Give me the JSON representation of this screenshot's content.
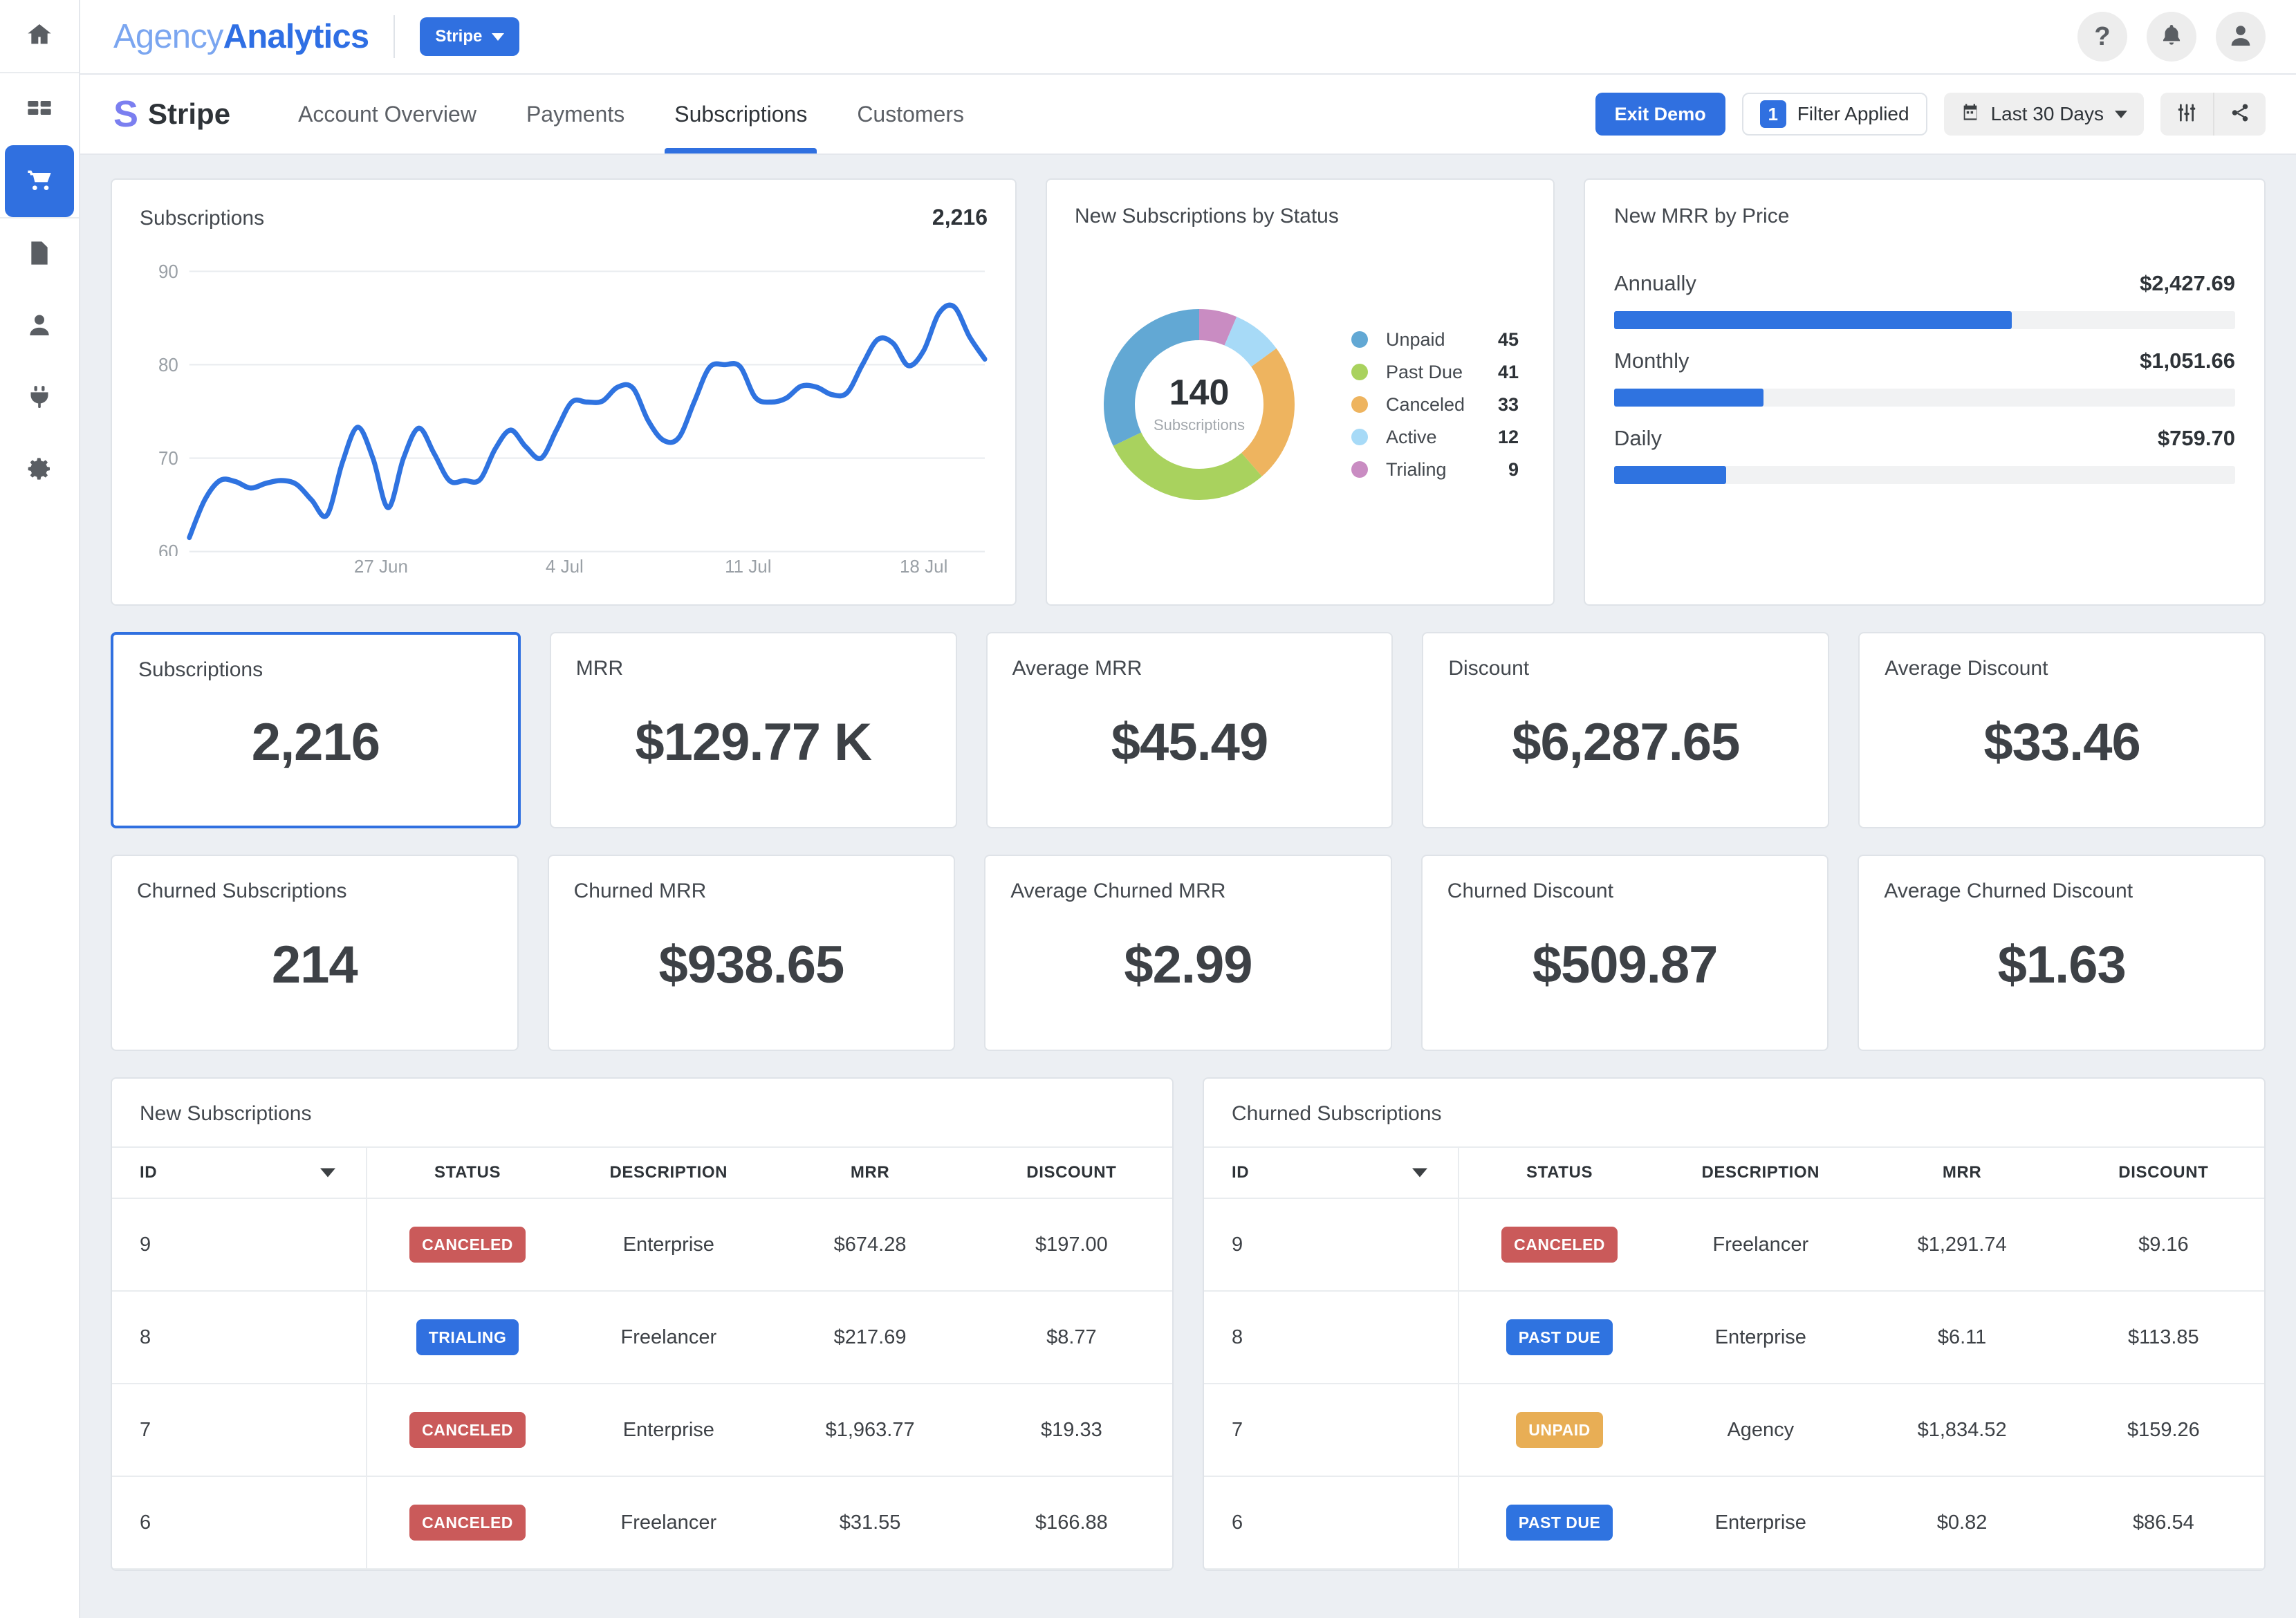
{
  "rail": {
    "items": [
      {
        "name": "home-icon",
        "active": false
      },
      {
        "name": "dashboard-grid-icon",
        "active": false
      },
      {
        "name": "cart-icon",
        "active": true
      },
      {
        "name": "report-file-icon",
        "active": false
      },
      {
        "name": "user-icon",
        "active": false
      },
      {
        "name": "plug-icon",
        "active": false
      },
      {
        "name": "gear-icon",
        "active": false
      }
    ]
  },
  "brandbar": {
    "logo_part1": "Agency",
    "logo_part2": "Analytics",
    "account_label": "Stripe",
    "help_glyph": "?",
    "icons": [
      "help-icon",
      "bell-icon",
      "avatar-icon"
    ]
  },
  "nav": {
    "mark": "S",
    "name": "Stripe",
    "tabs": [
      {
        "label": "Account Overview",
        "active": false
      },
      {
        "label": "Payments",
        "active": false
      },
      {
        "label": "Subscriptions",
        "active": true
      },
      {
        "label": "Customers",
        "active": false
      }
    ],
    "exit_demo": "Exit Demo",
    "filter_count": "1",
    "filter_label": "Filter Applied",
    "date_range": "Last 30 Days"
  },
  "subscriptions_panel": {
    "title": "Subscriptions",
    "total": "2,216"
  },
  "donut_panel": {
    "title": "New Subscriptions by Status",
    "center_value": "140",
    "center_label": "Subscriptions"
  },
  "mrr_panel": {
    "title": "New MRR by Price",
    "items": [
      {
        "label": "Annually",
        "value": "$2,427.69",
        "pct": 64
      },
      {
        "label": "Monthly",
        "value": "$1,051.66",
        "pct": 24
      },
      {
        "label": "Daily",
        "value": "$759.70",
        "pct": 18
      }
    ]
  },
  "kpis_row1": [
    {
      "label": "Subscriptions",
      "value": "2,216",
      "selected": true
    },
    {
      "label": "MRR",
      "value": "$129.77 K",
      "selected": false
    },
    {
      "label": "Average MRR",
      "value": "$45.49",
      "selected": false
    },
    {
      "label": "Discount",
      "value": "$6,287.65",
      "selected": false
    },
    {
      "label": "Average Discount",
      "value": "$33.46",
      "selected": false
    }
  ],
  "kpis_row2": [
    {
      "label": "Churned Subscriptions",
      "value": "214",
      "selected": false
    },
    {
      "label": "Churned MRR",
      "value": "$938.65",
      "selected": false
    },
    {
      "label": "Average Churned MRR",
      "value": "$2.99",
      "selected": false
    },
    {
      "label": "Churned Discount",
      "value": "$509.87",
      "selected": false
    },
    {
      "label": "Average Churned Discount",
      "value": "$1.63",
      "selected": false
    }
  ],
  "table_new": {
    "title": "New Subscriptions",
    "columns": [
      "ID",
      "STATUS",
      "DESCRIPTION",
      "MRR",
      "DISCOUNT"
    ],
    "rows": [
      {
        "id": "9",
        "status": "CANCELED",
        "status_kind": "canceled",
        "description": "Enterprise",
        "mrr": "$674.28",
        "discount": "$197.00"
      },
      {
        "id": "8",
        "status": "TRIALING",
        "status_kind": "trialing",
        "description": "Freelancer",
        "mrr": "$217.69",
        "discount": "$8.77"
      },
      {
        "id": "7",
        "status": "CANCELED",
        "status_kind": "canceled",
        "description": "Enterprise",
        "mrr": "$1,963.77",
        "discount": "$19.33"
      },
      {
        "id": "6",
        "status": "CANCELED",
        "status_kind": "canceled",
        "description": "Freelancer",
        "mrr": "$31.55",
        "discount": "$166.88"
      }
    ]
  },
  "table_churned": {
    "title": "Churned Subscriptions",
    "columns": [
      "ID",
      "STATUS",
      "DESCRIPTION",
      "MRR",
      "DISCOUNT"
    ],
    "rows": [
      {
        "id": "9",
        "status": "CANCELED",
        "status_kind": "canceled",
        "description": "Freelancer",
        "mrr": "$1,291.74",
        "discount": "$9.16"
      },
      {
        "id": "8",
        "status": "PAST DUE",
        "status_kind": "pastdue",
        "description": "Enterprise",
        "mrr": "$6.11",
        "discount": "$113.85"
      },
      {
        "id": "7",
        "status": "UNPAID",
        "status_kind": "unpaid",
        "description": "Agency",
        "mrr": "$1,834.52",
        "discount": "$159.26"
      },
      {
        "id": "6",
        "status": "PAST DUE",
        "status_kind": "pastdue",
        "description": "Enterprise",
        "mrr": "$0.82",
        "discount": "$86.54"
      }
    ]
  },
  "colors": {
    "accent": "#3070e0",
    "line": "#2f73e0",
    "unpaid": "#62a8d4",
    "past_due": "#a9d25e",
    "canceled": "#eeb45f",
    "active": "#a7daf7",
    "trialing": "#c98cc2",
    "canceled_pill": "#ca5a5a",
    "trialing_pill": "#3070e0",
    "unpaid_pill": "#e8ae55"
  },
  "chart_data": {
    "type": "line",
    "title": "Subscriptions",
    "xlabel": "",
    "ylabel": "",
    "ylim": [
      60,
      92
    ],
    "grid": true,
    "tick_labels_y": [
      "60",
      "70",
      "80",
      "90"
    ],
    "x_tick_labels": [
      "27 Jun",
      "4 Jul",
      "11 Jul",
      "18 Jul"
    ],
    "x_tick_positions_pct": [
      24,
      47,
      70,
      92
    ],
    "series": [
      {
        "name": "Subscriptions",
        "values": [
          61.5,
          65.5,
          67.6,
          67.5,
          66.8,
          67.3,
          67.6,
          67.2,
          65.5,
          63.9,
          69.5,
          73.3,
          70.0,
          64.7,
          70.0,
          73.2,
          70.5,
          67.6,
          67.6,
          67.7,
          71.0,
          73.0,
          71.2,
          70.0,
          73.0,
          76.0,
          76.0,
          76.1,
          77.6,
          77.5,
          74.0,
          71.9,
          72.2,
          76.0,
          79.7,
          80.0,
          79.8,
          76.5,
          76.0,
          76.4,
          77.7,
          77.6,
          76.8,
          77.0,
          80.0,
          82.7,
          82.3,
          79.9,
          81.5,
          85.5,
          86.2,
          83.0,
          80.6
        ]
      }
    ],
    "legend": "none"
  },
  "donut_chart_data": {
    "type": "pie",
    "title": "New Subscriptions by Status",
    "total": 140,
    "categories": [
      "Unpaid",
      "Past Due",
      "Canceled",
      "Active",
      "Trialing"
    ],
    "values": [
      45,
      41,
      33,
      12,
      9
    ],
    "colors": [
      "#62a8d4",
      "#a9d25e",
      "#eeb45f",
      "#a7daf7",
      "#c98cc2"
    ],
    "legend": "right"
  },
  "mrr_chart_data": {
    "type": "bar",
    "title": "New MRR by Price",
    "orientation": "horizontal",
    "categories": [
      "Annually",
      "Monthly",
      "Daily"
    ],
    "values": [
      2427.69,
      1051.66,
      759.7
    ],
    "value_labels": [
      "$2,427.69",
      "$1,051.66",
      "$759.70"
    ],
    "bar_pct": [
      64,
      24,
      18
    ]
  }
}
